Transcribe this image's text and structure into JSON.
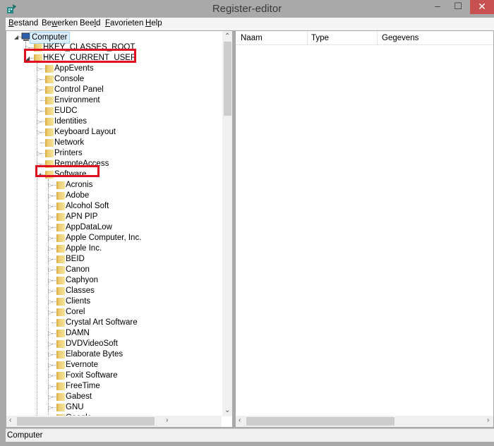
{
  "window": {
    "title": "Register-editor",
    "minimize": "–",
    "maximize": "☐",
    "close": "✕"
  },
  "menu": [
    {
      "label": "Bestand",
      "accel": "B",
      "rest": "estand"
    },
    {
      "label": "Bewerken",
      "pre": "Be",
      "accel": "w",
      "rest": "erken"
    },
    {
      "label": "Beeld",
      "pre": "Bee",
      "accel": "l",
      "rest": "d"
    },
    {
      "label": "Favorieten",
      "accel": "F",
      "rest": "avorieten"
    },
    {
      "label": "Help",
      "accel": "H",
      "rest": "elp"
    }
  ],
  "tree": [
    {
      "label": "Computer",
      "level": 0,
      "state": "expanded",
      "selected": true,
      "icon": "computer"
    },
    {
      "label": "HKEY_CLASSES_ROOT",
      "level": 1,
      "state": "collapsed"
    },
    {
      "label": "HKEY_CURRENT_USER",
      "level": 1,
      "state": "expanded",
      "highlighted": true
    },
    {
      "label": "AppEvents",
      "level": 2,
      "state": "collapsed"
    },
    {
      "label": "Console",
      "level": 2,
      "state": "collapsed"
    },
    {
      "label": "Control Panel",
      "level": 2,
      "state": "collapsed"
    },
    {
      "label": "Environment",
      "level": 2,
      "state": "leaf"
    },
    {
      "label": "EUDC",
      "level": 2,
      "state": "collapsed"
    },
    {
      "label": "Identities",
      "level": 2,
      "state": "collapsed"
    },
    {
      "label": "Keyboard Layout",
      "level": 2,
      "state": "collapsed"
    },
    {
      "label": "Network",
      "level": 2,
      "state": "leaf"
    },
    {
      "label": "Printers",
      "level": 2,
      "state": "collapsed"
    },
    {
      "label": "RemoteAccess",
      "level": 2,
      "state": "collapsed"
    },
    {
      "label": "Software",
      "level": 2,
      "state": "expanded",
      "highlighted": true
    },
    {
      "label": "Acronis",
      "level": 3,
      "state": "collapsed"
    },
    {
      "label": "Adobe",
      "level": 3,
      "state": "collapsed"
    },
    {
      "label": "Alcohol Soft",
      "level": 3,
      "state": "collapsed"
    },
    {
      "label": "APN PIP",
      "level": 3,
      "state": "collapsed"
    },
    {
      "label": "AppDataLow",
      "level": 3,
      "state": "collapsed"
    },
    {
      "label": "Apple Computer, Inc.",
      "level": 3,
      "state": "collapsed"
    },
    {
      "label": "Apple Inc.",
      "level": 3,
      "state": "collapsed"
    },
    {
      "label": "BEID",
      "level": 3,
      "state": "collapsed"
    },
    {
      "label": "Canon",
      "level": 3,
      "state": "collapsed"
    },
    {
      "label": "Caphyon",
      "level": 3,
      "state": "collapsed"
    },
    {
      "label": "Classes",
      "level": 3,
      "state": "collapsed"
    },
    {
      "label": "Clients",
      "level": 3,
      "state": "collapsed"
    },
    {
      "label": "Corel",
      "level": 3,
      "state": "collapsed"
    },
    {
      "label": "Crystal Art Software",
      "level": 3,
      "state": "leaf"
    },
    {
      "label": "DAMN",
      "level": 3,
      "state": "collapsed"
    },
    {
      "label": "DVDVideoSoft",
      "level": 3,
      "state": "collapsed"
    },
    {
      "label": "Elaborate Bytes",
      "level": 3,
      "state": "collapsed"
    },
    {
      "label": "Evernote",
      "level": 3,
      "state": "collapsed"
    },
    {
      "label": "Foxit Software",
      "level": 3,
      "state": "collapsed"
    },
    {
      "label": "FreeTime",
      "level": 3,
      "state": "collapsed"
    },
    {
      "label": "Gabest",
      "level": 3,
      "state": "collapsed"
    },
    {
      "label": "GNU",
      "level": 3,
      "state": "collapsed"
    },
    {
      "label": "Google",
      "level": 3,
      "state": "collapsed"
    }
  ],
  "columns": [
    "Naam",
    "Type",
    "Gegevens"
  ],
  "status": "Computer",
  "colors": {
    "highlight": "#e01020",
    "title_bg": "#a9a9a9",
    "close_bg": "#c75050"
  }
}
